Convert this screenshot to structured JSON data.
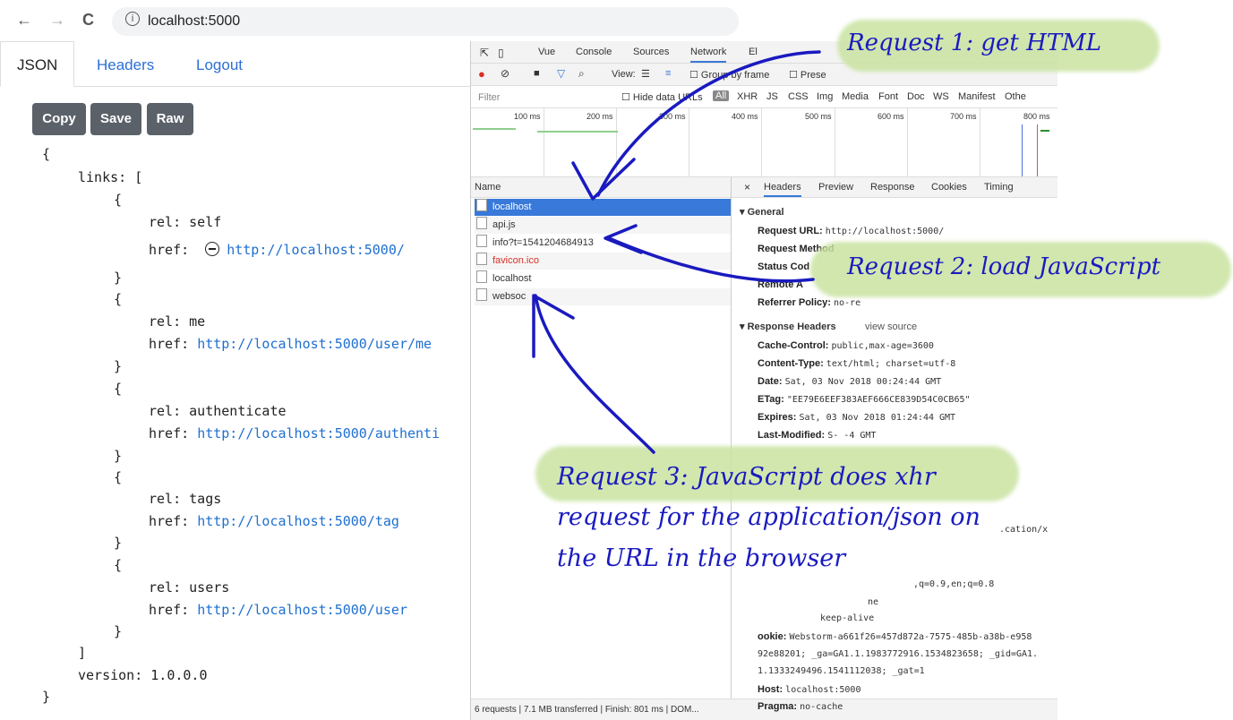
{
  "browser": {
    "url": "localhost:5000",
    "back_glyph": "←",
    "forward_glyph": "→",
    "reload_glyph": "C",
    "info_glyph": "i"
  },
  "app": {
    "tabs": [
      "JSON",
      "Headers",
      "Logout"
    ],
    "buttons": [
      "Copy",
      "Save",
      "Raw"
    ],
    "code": {
      "open_brace": "{",
      "links_label": "links: [",
      "entries": [
        {
          "rel": "rel: self",
          "href_label": "href:",
          "href": "http://localhost:5000/"
        },
        {
          "rel": "rel: me",
          "href_label": "href:",
          "href": "http://localhost:5000/user/me"
        },
        {
          "rel": "rel: authenticate",
          "href_label": "href:",
          "href": "http://localhost:5000/authenti"
        },
        {
          "rel": "rel: tags",
          "href_label": "href:",
          "href": "http://localhost:5000/tag"
        },
        {
          "rel": "rel: users",
          "href_label": "href:",
          "href": "http://localhost:5000/user"
        }
      ],
      "entry_open": "{",
      "entry_close": "}",
      "links_close": "]",
      "version": "version: 1.0.0.0",
      "close_brace": "}"
    }
  },
  "devtools": {
    "tabs": [
      "Vue",
      "Console",
      "Sources",
      "Network",
      "El"
    ],
    "toolbar": {
      "view": "View:",
      "group_by_frame": "Group by frame",
      "preserve": "Prese"
    },
    "filter": {
      "placeholder": "Filter",
      "hide_data_urls": "Hide data URLs",
      "all": "All",
      "types": [
        "XHR",
        "JS",
        "CSS",
        "Img",
        "Media",
        "Font",
        "Doc",
        "WS",
        "Manifest",
        "Othe"
      ]
    },
    "timeline_ticks": [
      "100 ms",
      "200 ms",
      "300 ms",
      "400 ms",
      "500 ms",
      "600 ms",
      "700 ms",
      "800 ms"
    ],
    "name_header": "Name",
    "requests": [
      {
        "name": "localhost",
        "selected": true,
        "error": false
      },
      {
        "name": "api.js",
        "selected": false,
        "error": false
      },
      {
        "name": "info?t=1541204684913",
        "selected": false,
        "error": false
      },
      {
        "name": "favicon.ico",
        "selected": false,
        "error": true
      },
      {
        "name": "localhost",
        "selected": false,
        "error": false
      },
      {
        "name": "websoc",
        "selected": false,
        "error": false
      }
    ],
    "status_bar": "6 requests | 7.1 MB transferred | Finish: 801 ms | DOM...",
    "detail_tabs": [
      "Headers",
      "Preview",
      "Response",
      "Cookies",
      "Timing"
    ],
    "close_glyph": "×",
    "general_title": "▾ General",
    "general": [
      {
        "k": "Request URL:",
        "v": "http://localhost:5000/"
      },
      {
        "k": "Request Method",
        "v": ""
      },
      {
        "k": "Status Cod",
        "v": ""
      },
      {
        "k": "Remote A",
        "v": ""
      },
      {
        "k": "Referrer Policy:",
        "v": "no-re"
      }
    ],
    "response_title": "▾ Response Headers",
    "view_source": "view source",
    "response": [
      {
        "k": "Cache-Control:",
        "v": "public,max-age=3600"
      },
      {
        "k": "Content-Type:",
        "v": "text/html; charset=utf-8"
      },
      {
        "k": "Date:",
        "v": "Sat, 03 Nov 2018 00:24:44 GMT"
      },
      {
        "k": "ETag:",
        "v": "\"EE79E6EEF383AEF666CE839D54C0CB65\""
      },
      {
        "k": "Expires:",
        "v": "Sat, 03 Nov 2018 01:24:44 GMT"
      },
      {
        "k": "Last-Modified:",
        "v": "S-                       -4 GMT"
      }
    ],
    "fragments": {
      "cation": ".cation/x",
      "lang": ",q=0.9,en;q=0.8",
      "ne": "ne",
      "keepalive": "keep-alive",
      "cookie_k": "ookie:",
      "cookie_v1": "Webstorm-a661f26=457d872a-7575-485b-a38b-e958",
      "cookie_v2": "92e88201; _ga=GA1.1.1983772916.1534823658; _gid=GA1.",
      "cookie_v3": "1.1333249496.1541112038; _gat=1",
      "host_k": "Host:",
      "host_v": "localhost:5000",
      "pragma_k": "Pragma:",
      "pragma_v": "no-cache"
    }
  },
  "annotations": {
    "note1": "Request  1: get HTML",
    "note2": "Request 2: load JavaScript",
    "note3_line1": "Request 3: JavaScript does xhr",
    "note3_line2": "request for the application/json on",
    "note3_line3": "the URL in the browser",
    "highlight_color": "#c9e3a1",
    "ink_color": "#1a1ac0"
  }
}
